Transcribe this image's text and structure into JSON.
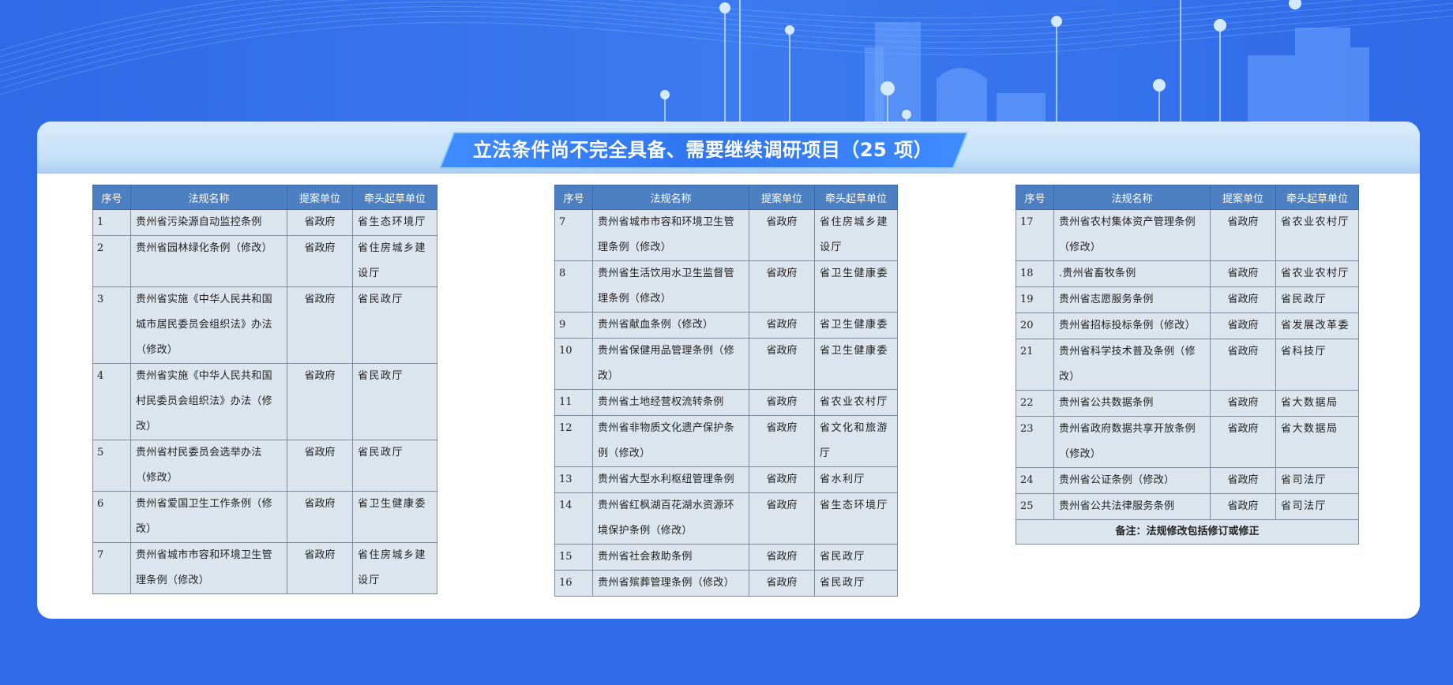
{
  "title": "立法条件尚不完全具备、需要继续调研项目（25 项）",
  "columns": [
    "序号",
    "法规名称",
    "提案单位",
    "牵头起草单位"
  ],
  "tables": [
    {
      "rows": [
        {
          "no": "1",
          "name": "贵州省污染源自动监控条例",
          "unit": "省政府",
          "lead": "省生态环境厅"
        },
        {
          "no": "2",
          "name": "贵州省园林绿化条例（修改）",
          "unit": "省政府",
          "lead": "省住房城乡建设厅"
        },
        {
          "no": "3",
          "name": "贵州省实施《中华人民共和国城市居民委员会组织法》办法（修改）",
          "unit": "省政府",
          "lead": "省民政厅"
        },
        {
          "no": "4",
          "name": "贵州省实施《中华人民共和国村民委员会组织法》办法（修改）",
          "unit": "省政府",
          "lead": "省民政厅"
        },
        {
          "no": "5",
          "name": "贵州省村民委员会选举办法（修改）",
          "unit": "省政府",
          "lead": "省民政厅"
        },
        {
          "no": "6",
          "name": "贵州省爱国卫生工作条例（修改）",
          "unit": "省政府",
          "lead": "省卫生健康委"
        },
        {
          "no": "7",
          "name": "贵州省城市市容和环境卫生管理条例（修改）",
          "unit": "省政府",
          "lead": "省住房城乡建设厅"
        }
      ]
    },
    {
      "rows": [
        {
          "no": "7",
          "name": "贵州省城市市容和环境卫生管理条例（修改）",
          "unit": "省政府",
          "lead": "省住房城乡建设厅"
        },
        {
          "no": "8",
          "name": "贵州省生活饮用水卫生监督管理条例（修改）",
          "unit": "省政府",
          "lead": "省卫生健康委"
        },
        {
          "no": "9",
          "name": "贵州省献血条例（修改）",
          "unit": "省政府",
          "lead": "省卫生健康委"
        },
        {
          "no": "10",
          "name": "贵州省保健用品管理条例（修改）",
          "unit": "省政府",
          "lead": "省卫生健康委"
        },
        {
          "no": "11",
          "name": "贵州省土地经营权流转条例",
          "unit": "省政府",
          "lead": "省农业农村厅"
        },
        {
          "no": "12",
          "name": "贵州省非物质文化遗产保护条例（修改）",
          "unit": "省政府",
          "lead": "省文化和旅游厅"
        },
        {
          "no": "13",
          "name": "贵州省大型水利枢纽管理条例",
          "unit": "省政府",
          "lead": "省水利厅"
        },
        {
          "no": "14",
          "name": "贵州省红枫湖百花湖水资源环境保护条例（修改）",
          "unit": "省政府",
          "lead": "省生态环境厅"
        },
        {
          "no": "15",
          "name": "贵州省社会救助条例",
          "unit": "省政府",
          "lead": "省民政厅"
        },
        {
          "no": "16",
          "name": "贵州省殡葬管理条例（修改）",
          "unit": "省政府",
          "lead": "省民政厅"
        }
      ]
    },
    {
      "rows": [
        {
          "no": "17",
          "name": "贵州省农村集体资产管理条例（修改）",
          "unit": "省政府",
          "lead": "省农业农村厅"
        },
        {
          "no": "18",
          "name": ".贵州省畜牧条例",
          "unit": "省政府",
          "lead": "省农业农村厅"
        },
        {
          "no": "19",
          "name": "贵州省志愿服务条例",
          "unit": "省政府",
          "lead": "省民政厅"
        },
        {
          "no": "20",
          "name": "贵州省招标投标条例（修改）",
          "unit": "省政府",
          "lead": "省发展改革委"
        },
        {
          "no": "21",
          "name": "贵州省科学技术普及条例（修改）",
          "unit": "省政府",
          "lead": "省科技厅"
        },
        {
          "no": "22",
          "name": "贵州省公共数据条例",
          "unit": "省政府",
          "lead": "省大数据局"
        },
        {
          "no": "23",
          "name": "贵州省政府数据共享开放条例（修改）",
          "unit": "省政府",
          "lead": "省大数据局"
        },
        {
          "no": "24",
          "name": "贵州省公证条例（修改）",
          "unit": "省政府",
          "lead": "省司法厅"
        },
        {
          "no": "25",
          "name": "贵州省公共法律服务条例",
          "unit": "省政府",
          "lead": "省司法厅"
        }
      ],
      "note": "备注：法规修改包括修订或修正"
    }
  ],
  "colors": {
    "background": "#2f6ae8",
    "header": "#4d7fc3",
    "cell": "#dce4ee",
    "title_bar": "#2f74f0"
  }
}
